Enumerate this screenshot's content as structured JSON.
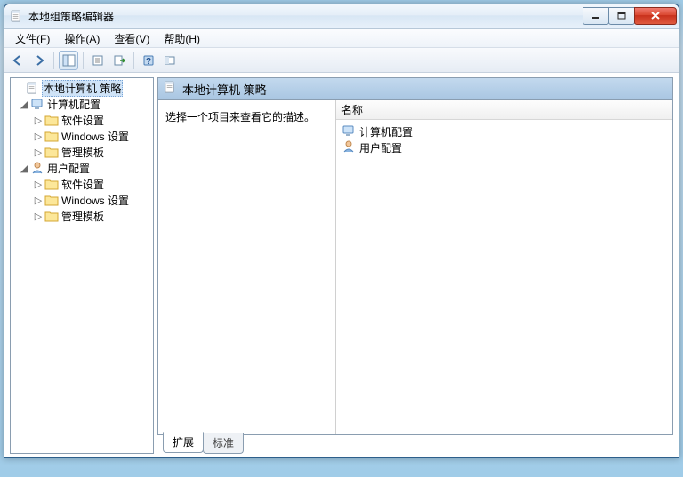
{
  "window": {
    "title": "本地组策略编辑器"
  },
  "menu": {
    "file": "文件(F)",
    "action": "操作(A)",
    "view": "查看(V)",
    "help": "帮助(H)"
  },
  "tree": {
    "root": "本地计算机 策略",
    "computer": "计算机配置",
    "computer_children": {
      "software": "软件设置",
      "windows": "Windows 设置",
      "templates": "管理模板"
    },
    "user": "用户配置",
    "user_children": {
      "software": "软件设置",
      "windows": "Windows 设置",
      "templates": "管理模板"
    }
  },
  "header": {
    "title": "本地计算机 策略"
  },
  "description": {
    "prompt": "选择一个项目来查看它的描述。"
  },
  "list": {
    "column": "名称",
    "items": {
      "computer": "计算机配置",
      "user": "用户配置"
    }
  },
  "tabs": {
    "extended": "扩展",
    "standard": "标准"
  }
}
